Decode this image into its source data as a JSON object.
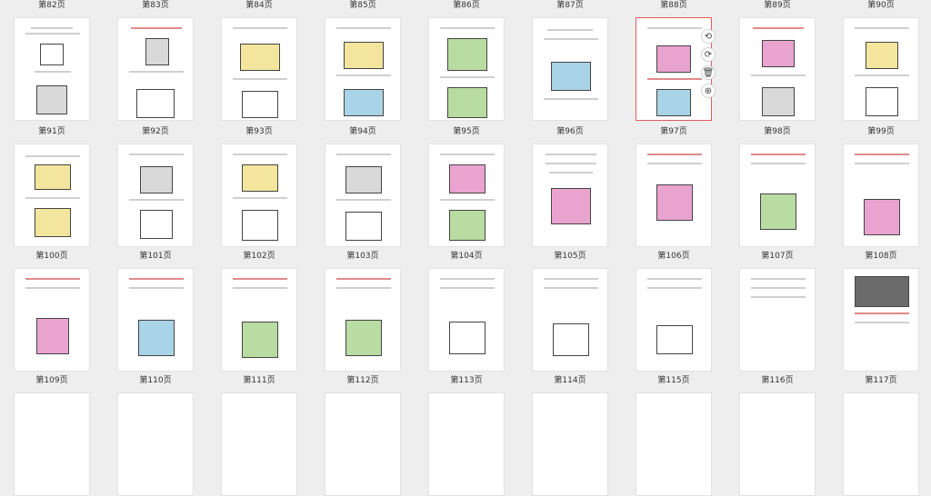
{
  "top_labels": [
    "第82页",
    "第83页",
    "第84页",
    "第85页",
    "第86页",
    "第87页",
    "第88页",
    "第89页",
    "第90页"
  ],
  "rows": [
    {
      "labels": [
        "第91页",
        "第92页",
        "第93页",
        "第94页",
        "第95页",
        "第96页",
        "第97页",
        "第98页",
        "第99页"
      ]
    },
    {
      "labels": [
        "第100页",
        "第101页",
        "第102页",
        "第103页",
        "第104页",
        "第105页",
        "第106页",
        "第107页",
        "第108页"
      ]
    },
    {
      "labels": [
        "第109页",
        "第110页",
        "第111页",
        "第112页",
        "第113页",
        "第114页",
        "第115页",
        "第116页",
        "第117页"
      ]
    }
  ],
  "selected_page": "第97页",
  "toolbar": {
    "rotate_left_icon": "rotate-left-icon",
    "rotate_right_icon": "rotate-right-icon",
    "delete_icon": "trash-icon",
    "zoom_icon": "zoom-icon"
  },
  "colors": {
    "selection": "#e45a5a",
    "page_bg": "#ffffff",
    "canvas_bg": "#eeeeee"
  }
}
